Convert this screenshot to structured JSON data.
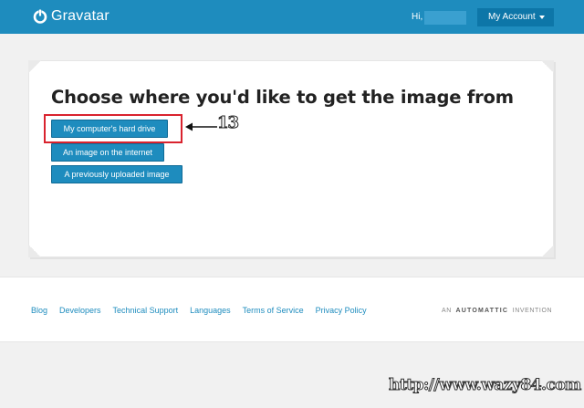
{
  "header": {
    "brand": "Gravatar",
    "greeting": "Hi,",
    "account_button": "My Account"
  },
  "main": {
    "title": "Choose where you'd like to get the image from",
    "options": [
      "My computer's hard drive",
      "An image on the internet",
      "A previously uploaded image"
    ]
  },
  "annotation": {
    "step": "13",
    "highlight_color": "#d9232e"
  },
  "footer": {
    "links": [
      "Blog",
      "Developers",
      "Technical Support",
      "Languages",
      "Terms of Service",
      "Privacy Policy"
    ],
    "invention_prefix": "AN",
    "invention_brand": "AUTOMATTIC",
    "invention_suffix": "INVENTION"
  },
  "watermark": "http://www.wazy84.com",
  "colors": {
    "brand_blue": "#1e8cbe",
    "button_blue": "#1e8cbe",
    "account_button": "#0d76a8"
  },
  "icons": {
    "logo": "gravatar-logo-icon",
    "account_caret": "caret-down-icon",
    "annotation_arrow": "arrow-left-icon"
  }
}
